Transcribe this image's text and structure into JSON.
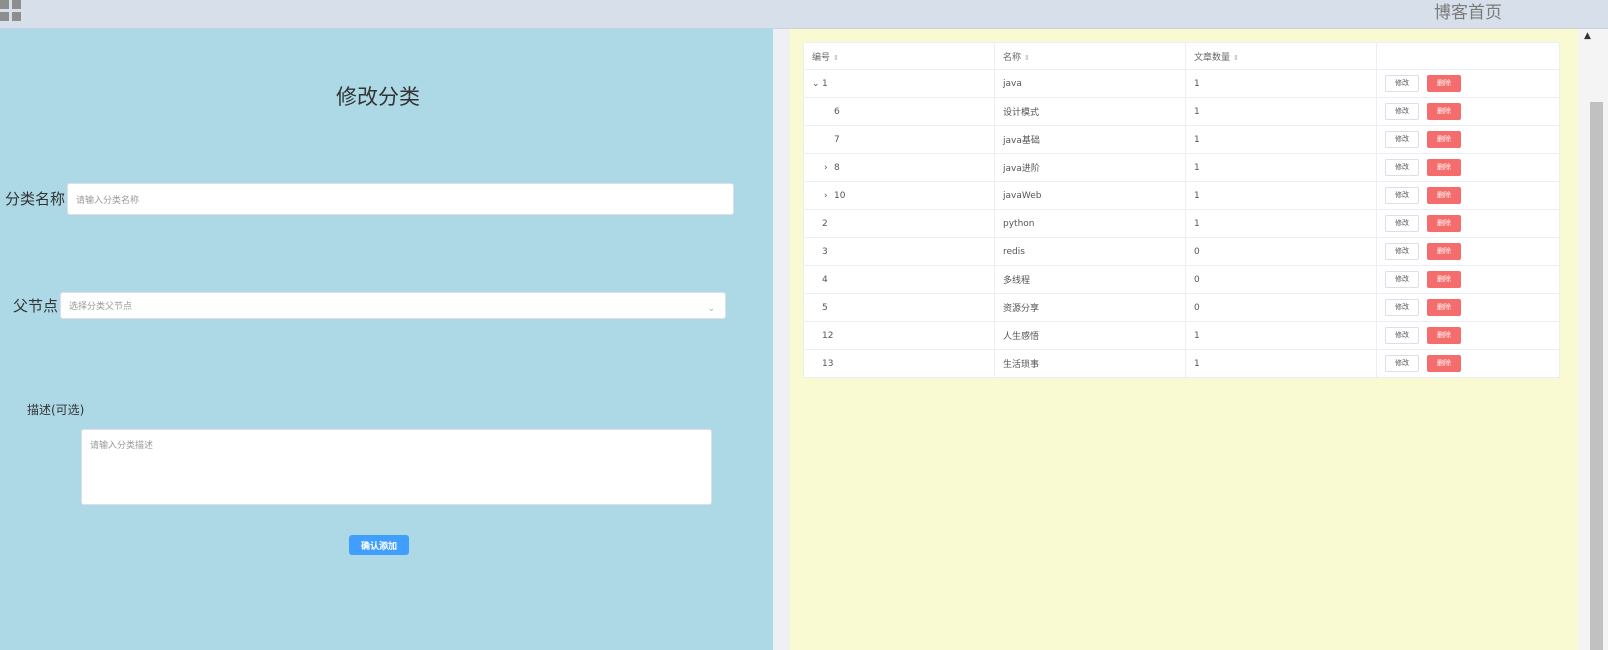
{
  "header": {
    "blog_home": "博客首页",
    "menu_icon": "grid-icon"
  },
  "form": {
    "title": "修改分类",
    "name_label": "分类名称",
    "name_placeholder": "请输入分类名称",
    "parent_label": "父节点",
    "parent_placeholder": "选择分类父节点",
    "desc_label": "描述(可选)",
    "desc_placeholder": "请输入分类描述",
    "confirm_label": "确认添加"
  },
  "table": {
    "headers": [
      "编号",
      "名称",
      "文章数量",
      ""
    ],
    "edit_label": "修改",
    "delete_label": "删除",
    "rows": [
      {
        "id": "1",
        "name": "java",
        "count": "1",
        "expander": "⌄",
        "level": 0
      },
      {
        "id": "6",
        "name": "设计模式",
        "count": "1",
        "expander": "",
        "level": 1
      },
      {
        "id": "7",
        "name": "java基础",
        "count": "1",
        "expander": "",
        "level": 1
      },
      {
        "id": "8",
        "name": "java进阶",
        "count": "1",
        "expander": "›",
        "level": 1
      },
      {
        "id": "10",
        "name": "javaWeb",
        "count": "1",
        "expander": "›",
        "level": 1
      },
      {
        "id": "2",
        "name": "python",
        "count": "1",
        "expander": "",
        "level": 0
      },
      {
        "id": "3",
        "name": "redis",
        "count": "0",
        "expander": "",
        "level": 0
      },
      {
        "id": "4",
        "name": "多线程",
        "count": "0",
        "expander": "",
        "level": 0
      },
      {
        "id": "5",
        "name": "资源分享",
        "count": "0",
        "expander": "",
        "level": 0
      },
      {
        "id": "12",
        "name": "人生感悟",
        "count": "1",
        "expander": "",
        "level": 0
      },
      {
        "id": "13",
        "name": "生活琐事",
        "count": "1",
        "expander": "",
        "level": 0
      }
    ]
  },
  "colors": {
    "left_bg": "#add8e6",
    "right_bg": "#fafad2",
    "primary": "#409eff",
    "danger": "#f56c6c"
  }
}
